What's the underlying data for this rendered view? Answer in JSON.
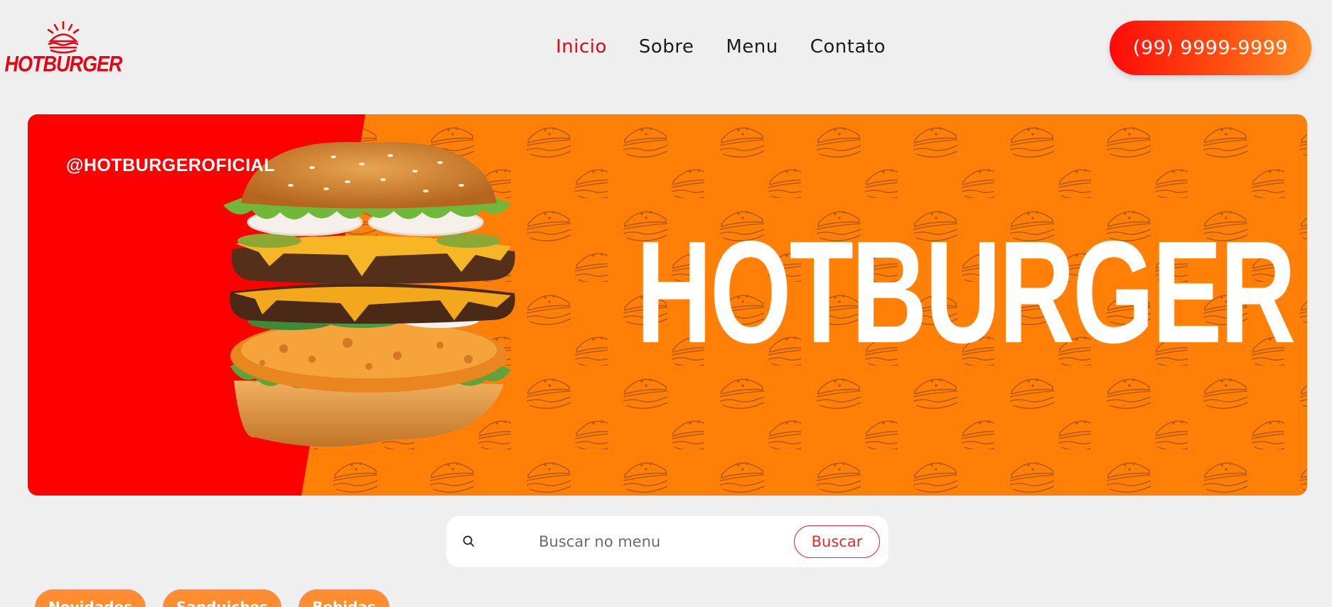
{
  "header": {
    "logo_text": "HOTBURGER",
    "nav": [
      {
        "label": "Inicio",
        "active": true
      },
      {
        "label": "Sobre",
        "active": false
      },
      {
        "label": "Menu",
        "active": false
      },
      {
        "label": "Contato",
        "active": false
      }
    ],
    "phone": "(99) 9999-9999"
  },
  "banner": {
    "handle": "@HOTBURGEROFICIAL",
    "title": "HOTBURGER"
  },
  "search": {
    "placeholder": "Buscar no menu",
    "button_label": "Buscar"
  },
  "categories": [
    "Novidades",
    "Sanduiches",
    "Bebidas"
  ],
  "colors": {
    "brand_red": "#e30613",
    "banner_orange": "#ff7f07",
    "banner_red": "#ff0000",
    "page_bg": "#efefef"
  }
}
